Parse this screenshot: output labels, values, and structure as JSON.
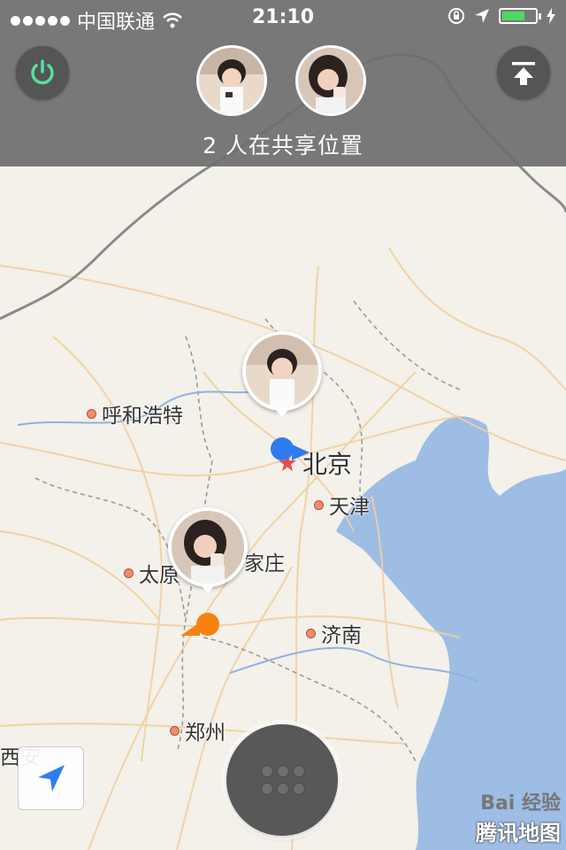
{
  "status_bar": {
    "carrier": "中国联通",
    "time": "21:10",
    "battery_level": 0.7
  },
  "header": {
    "share_text": "2 人在共享位置",
    "power_icon": "power-icon",
    "top_icon": "upload-top-icon"
  },
  "map": {
    "cities": [
      {
        "name": "呼和浩特"
      },
      {
        "name": "北京"
      },
      {
        "name": "天津"
      },
      {
        "name": "家庄"
      },
      {
        "name": "太原"
      },
      {
        "name": "济南"
      },
      {
        "name": "郑州"
      },
      {
        "name": "西安"
      }
    ]
  },
  "watermark": {
    "baidu": "Bai 经验",
    "tencent": "腾讯地图"
  },
  "colors": {
    "user_blue": "#2f7cf0",
    "user_orange": "#f5820f",
    "sea": "#9dbde5",
    "power_green": "#55e0a0"
  }
}
